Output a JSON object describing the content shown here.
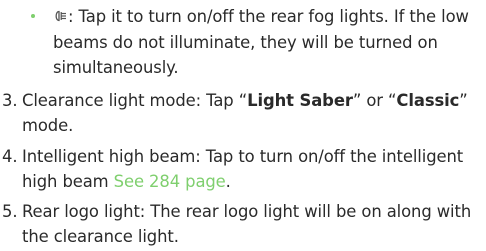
{
  "colors": {
    "accent": "#7fcf6e",
    "bullet": "#7fcf6e",
    "text": "#2a2a2a",
    "icon": "#555555"
  },
  "bullet_item": {
    "icon": "rear-fog-light-icon",
    "separator": ":",
    "text": " Tap it to turn on/off the rear fog lights. If the low beams do not illuminate, they will be turned on simultaneously."
  },
  "items": [
    {
      "number": "3.",
      "prefix": "Clearance light mode: Tap “",
      "bold1": "Light Saber",
      "middle": "” or “",
      "bold2": "Classic",
      "suffix": "” mode."
    },
    {
      "number": "4.",
      "text": "Intelligent high beam: Tap to turn on/off the intelligent high beam ",
      "link": "See 284 page",
      "suffix": "."
    },
    {
      "number": "5.",
      "text": "Rear logo light: The rear logo light will be on along with the clearance light."
    }
  ]
}
